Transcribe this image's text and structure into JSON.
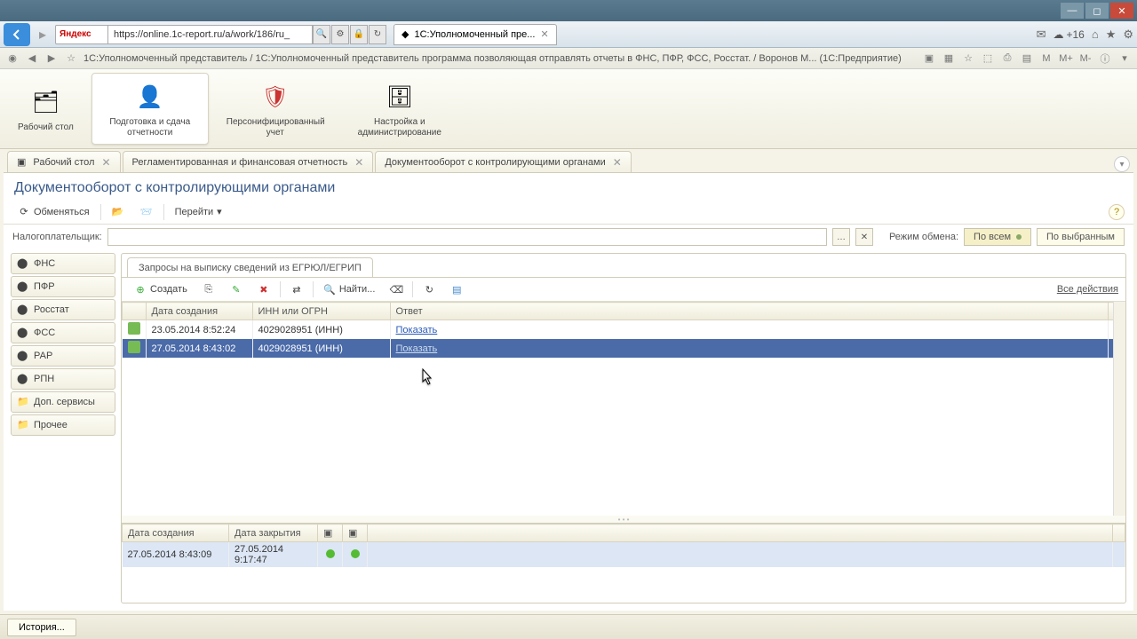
{
  "browser": {
    "url": "https://online.1c-report.ru/a/work/186/ru_",
    "tab_title": "1С:Уполномоченный пре...",
    "search_engine": "Яндекс",
    "weather": "+16",
    "page_long_title": "1С:Уполномоченный представитель / 1С:Уполномоченный представитель программа позволяющая отправлять отчеты в ФНС, ПФР, ФСС, Росстат. / Воронов М... (1С:Предприятие)"
  },
  "ribbon": [
    {
      "label": "Рабочий\nстол"
    },
    {
      "label": "Подготовка и\nсдача отчетности"
    },
    {
      "label": "Персонифицированный\nучет"
    },
    {
      "label": "Настройка и\nадминистрирование"
    }
  ],
  "app_tabs": [
    {
      "label": "Рабочий стол"
    },
    {
      "label": "Регламентированная и финансовая отчетность"
    },
    {
      "label": "Документооборот с контролирующими органами"
    }
  ],
  "page": {
    "title": "Документооборот с контролирующими органами",
    "toolbar": {
      "exchange": "Обменяться",
      "goto": "Перейти"
    },
    "filter_label": "Налогоплательщик:",
    "mode_label": "Режим обмена:",
    "mode_all": "По всем",
    "mode_selected": "По выбранным"
  },
  "sidebar": [
    "ФНС",
    "ПФР",
    "Росстат",
    "ФСС",
    "РАР",
    "РПН",
    "Доп. сервисы",
    "Прочее"
  ],
  "sub_tab": "Запросы на выписку сведений из ЕГРЮЛ/ЕГРИП",
  "grid_toolbar": {
    "create": "Создать",
    "find": "Найти...",
    "all_actions": "Все действия"
  },
  "grid": {
    "columns": [
      "",
      "Дата создания",
      "ИНН или ОГРН",
      "Ответ"
    ],
    "rows": [
      {
        "date": "23.05.2014 8:52:24",
        "inn": "4029028951 (ИНН)",
        "answer": "Показать",
        "selected": false
      },
      {
        "date": "27.05.2014 8:43:02",
        "inn": "4029028951 (ИНН)",
        "answer": "Показать",
        "selected": true
      }
    ]
  },
  "bottom_grid": {
    "columns": [
      "Дата создания",
      "Дата закрытия",
      "",
      ""
    ],
    "row": {
      "created": "27.05.2014 8:43:09",
      "closed": "27.05.2014 9:17:47"
    }
  },
  "statusbar": {
    "history": "История..."
  }
}
